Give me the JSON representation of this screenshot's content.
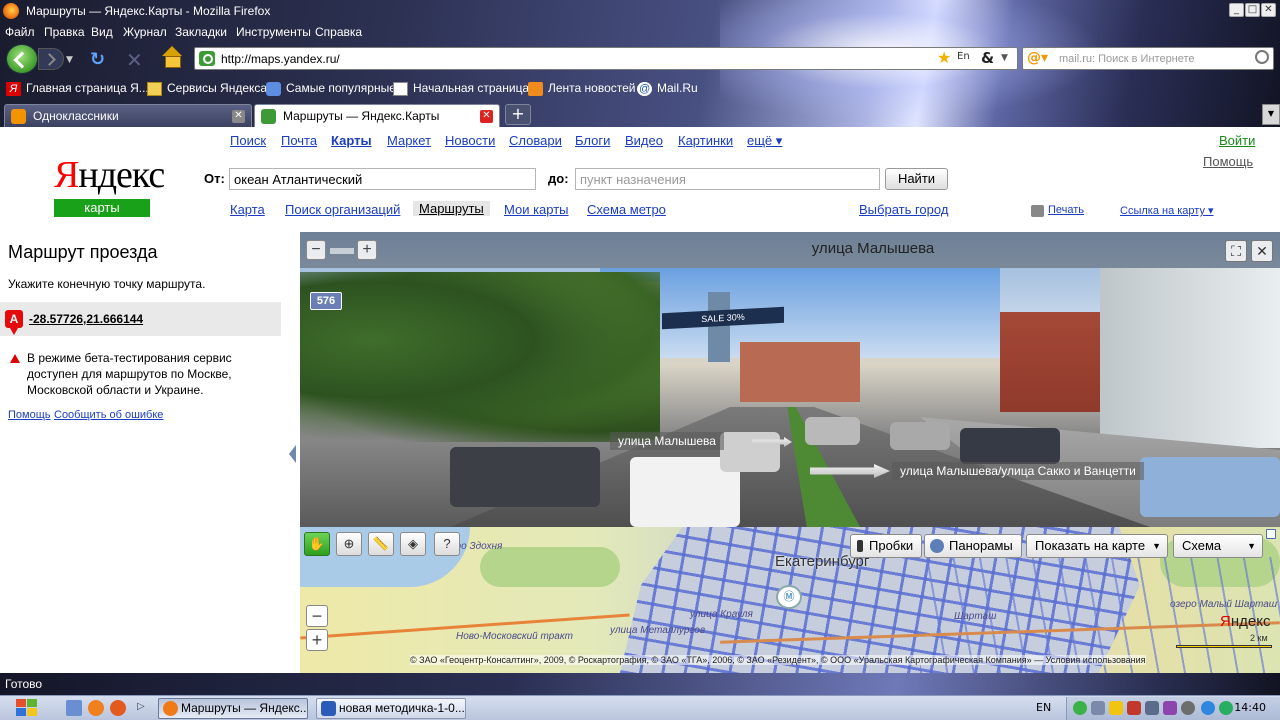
{
  "window": {
    "title": "Маршруты — Яндекс.Карты - Mozilla Firefox",
    "buttons": {
      "minimize": "_",
      "maximize": "□",
      "close": "✕"
    }
  },
  "menu": [
    "Файл",
    "Правка",
    "Вид",
    "Журнал",
    "Закладки",
    "Инструменты",
    "Справка"
  ],
  "nav": {
    "url": "http://maps.yandex.ru/",
    "search_placeholder": "mail.ru: Поиск в Интернете",
    "lang_indicator": "En",
    "amp": "&"
  },
  "bookmarks": [
    "Главная страница Я...",
    "Сервисы Яндекса",
    "Самые популярные",
    "Начальная страница",
    "Лента новостей",
    "Mail.Ru"
  ],
  "tabs": [
    {
      "label": "Одноклассники",
      "active": false
    },
    {
      "label": "Маршруты — Яндекс.Карты",
      "active": true
    }
  ],
  "newtab": "+",
  "yandex": {
    "top_nav": [
      "Поиск",
      "Почта",
      "Карты",
      "Маркет",
      "Новости",
      "Словари",
      "Блоги",
      "Видео",
      "Картинки",
      "ещё ▾"
    ],
    "login": "Войти",
    "help": "Помощь",
    "logo_red": "Я",
    "logo_rest": "ндекс",
    "logo_sub": "карты",
    "from_label": "От:",
    "from_value": "океан Атлантический",
    "to_label": "до:",
    "to_placeholder": "пункт назначения",
    "find_button": "Найти",
    "sub_nav": [
      "Карта",
      "Поиск организаций",
      "Маршруты",
      "Мои карты",
      "Схема метро"
    ],
    "choose_city": "Выбрать город",
    "print": "Печать",
    "map_link": "Ссылка на карту ▾"
  },
  "route_panel": {
    "title": "Маршрут проезда",
    "hint": "Укажите конечную точку маршрута.",
    "point_marker": "A",
    "point_coords": "-28.57726,21.666144",
    "beta_warning": "В режиме бета-тестирования сервис доступен для маршрутов по Москве, Московской области и Украине.",
    "links": [
      "Помощь",
      "Сообщить об ошибке"
    ]
  },
  "panorama": {
    "title": "улица Малышева",
    "zoom_out": "−",
    "zoom_in": "+",
    "route_number": "576",
    "billboard": "SALE 30%",
    "arrow_labels": [
      "улица Малышева",
      "улица Малышева/улица Сакко и Ванцетти"
    ]
  },
  "map": {
    "tools": [
      "✋",
      "⊕",
      "📏",
      "◈",
      "?"
    ],
    "buttons": {
      "traffic": "Пробки",
      "panoramas": "Панорамы",
      "show_on_map": "Показать на карте",
      "scheme": "Схема"
    },
    "city_label": "Екатеринбург",
    "labels": [
      "озеро Здохня",
      "Ново-Московский тракт",
      "улица Металлургов",
      "озеро Малый Шарташ",
      "улица Крауля",
      "Шарташ"
    ],
    "zoom_out": "−",
    "zoom_in": "+",
    "brand_red": "Я",
    "brand_rest": "ндекс",
    "scale": "2 км",
    "copyright": "© ЗАО «Геоцентр-Консалтинг», 2009, © Роскартография, © ЗАО «ТГА», 2006, © ЗАО «Резидент», © ООО «Уральская Картографическая Компания» — Условия использования"
  },
  "status": "Готово",
  "taskbar": {
    "tasks": [
      "Маршруты — Яндекс...",
      "новая методичка-1-0..."
    ],
    "lang": "EN",
    "clock": "14:40"
  }
}
